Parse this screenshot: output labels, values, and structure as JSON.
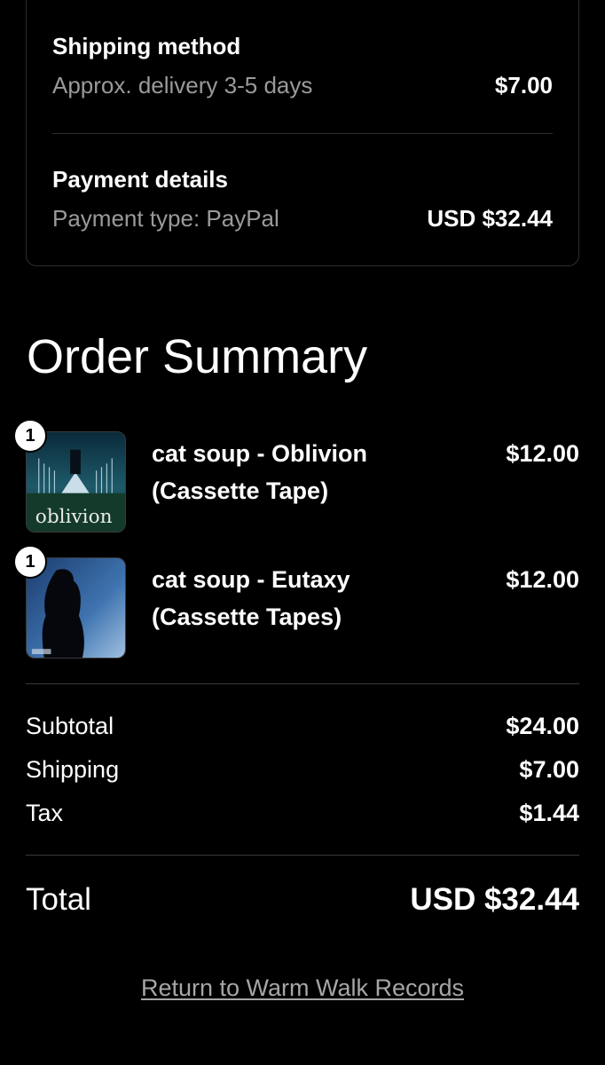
{
  "shipping_method": {
    "heading": "Shipping method",
    "detail": "Approx. delivery 3-5 days",
    "price": "$7.00"
  },
  "payment_details": {
    "heading": "Payment details",
    "detail": "Payment type: PayPal",
    "amount": "USD $32.44"
  },
  "order_summary": {
    "title": "Order Summary",
    "items": [
      {
        "qty": "1",
        "name": "cat soup - Oblivion (Cassette Tape)",
        "price": "$12.00",
        "art_text": "oblivion"
      },
      {
        "qty": "1",
        "name": "cat soup - Eutaxy (Cassette Tapes)",
        "price": "$12.00"
      }
    ]
  },
  "totals": {
    "subtotal_label": "Subtotal",
    "subtotal": "$24.00",
    "shipping_label": "Shipping",
    "shipping": "$7.00",
    "tax_label": "Tax",
    "tax": "$1.44",
    "total_label": "Total",
    "total": "USD $32.44"
  },
  "return_link": "Return to Warm Walk Records",
  "colors": {
    "background": "#000000",
    "text": "#ffffff",
    "muted": "#9a9a9a",
    "border": "#2e2e2e"
  }
}
